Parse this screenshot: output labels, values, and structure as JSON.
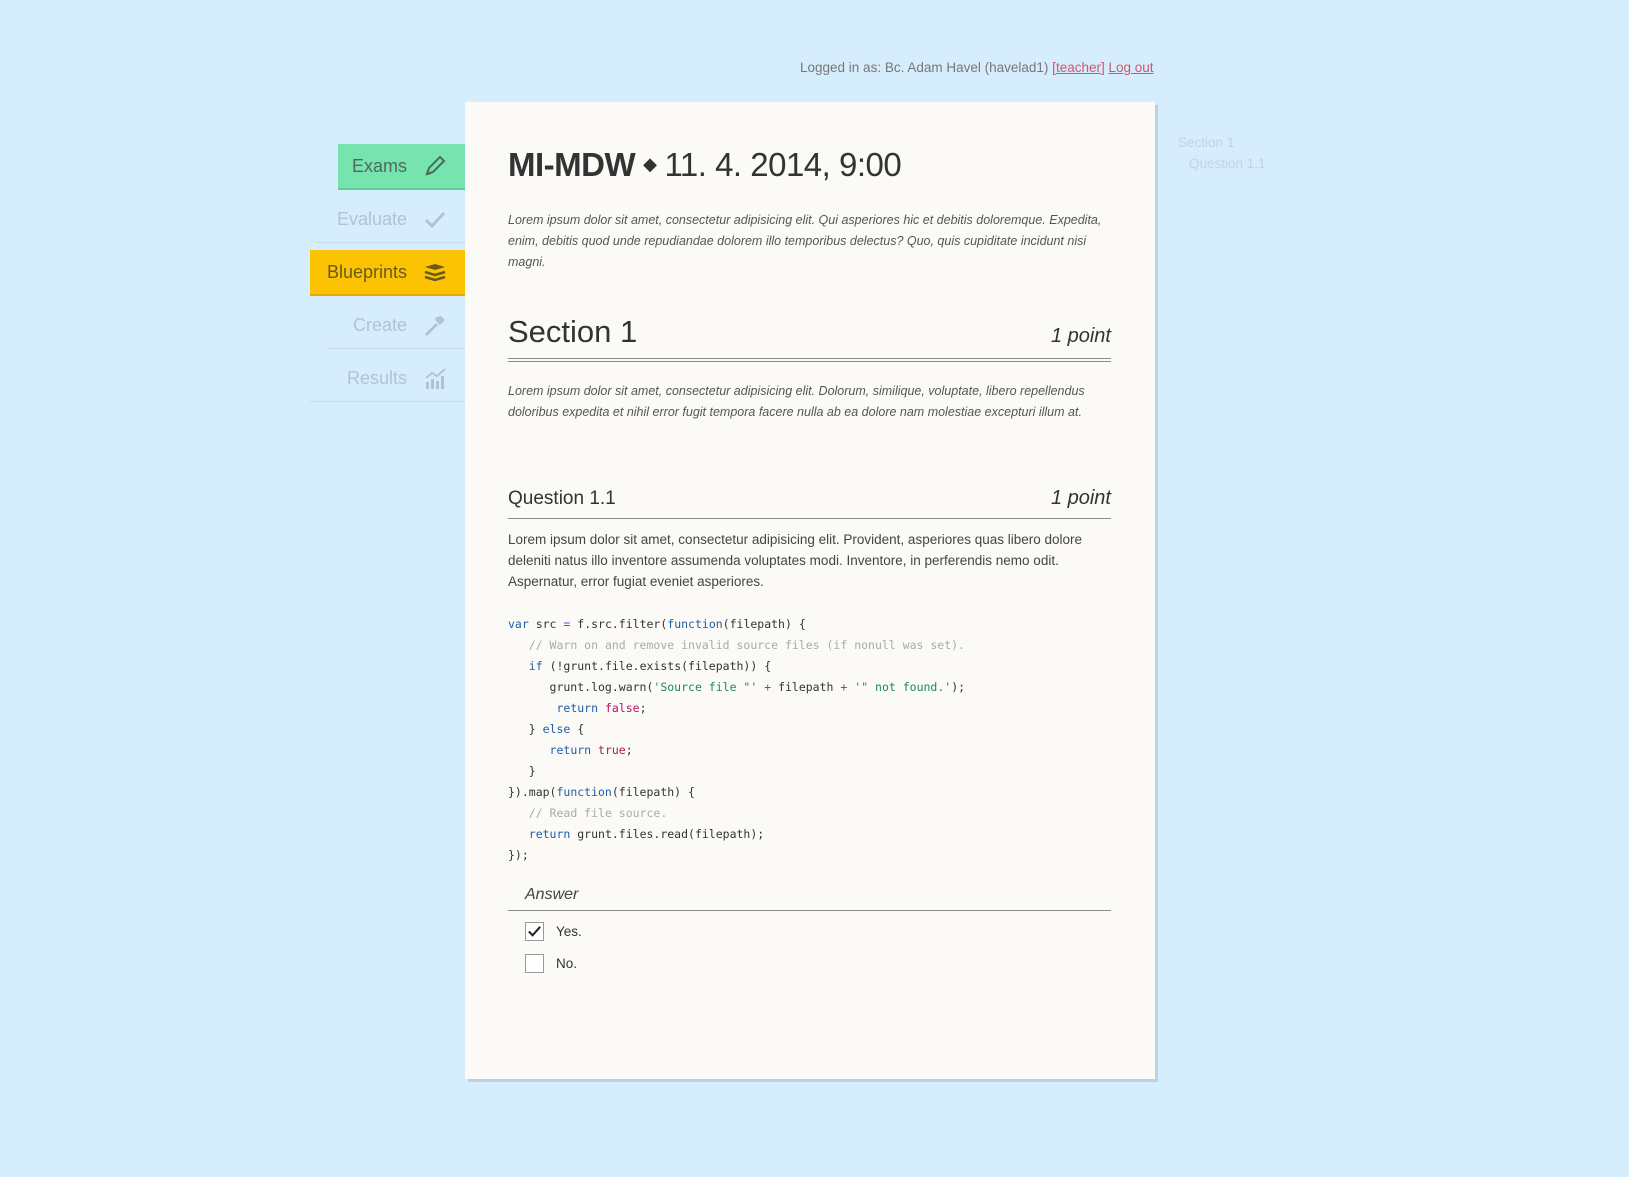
{
  "user_bar": {
    "prefix": "Logged in as: Bc. Adam Havel (havelad1)",
    "role": "teacher",
    "logout": "Log out"
  },
  "nav": {
    "items": [
      {
        "label": "Exams",
        "icon": "pencil-icon"
      },
      {
        "label": "Evaluate",
        "icon": "check-icon"
      },
      {
        "label": "Blueprints",
        "icon": "stack-icon"
      },
      {
        "label": "Create",
        "icon": "hammer-icon"
      },
      {
        "label": "Results",
        "icon": "chart-icon"
      }
    ]
  },
  "exam": {
    "course": "MI-MDW",
    "datetime": "11. 4. 2014, 9:00",
    "intro": "Lorem ipsum dolor sit amet, consectetur adipisicing elit. Qui asperiores hic et debitis doloremque. Expedita, enim, debitis quod unde repudiandae dolorem illo temporibus delectus? Quo, quis cupiditate incidunt nisi magni."
  },
  "section": {
    "title": "Section 1",
    "points": "1 point",
    "description": "Lorem ipsum dolor sit amet, consectetur adipisicing elit. Dolorum, similique, voluptate, libero repellendus doloribus expedita et nihil error fugit tempora facere nulla ab ea dolore nam molestiae excepturi illum at."
  },
  "question": {
    "title": "Question 1.1",
    "points": "1 point",
    "text": "Lorem ipsum dolor sit amet, consectetur adipisicing elit. Provident, asperiores quas libero dolore deleniti natus illo inventore assumenda voluptates modi. Inventore, in perferendis nemo odit. Aspernatur, error fugiat eveniet asperiores."
  },
  "answer": {
    "heading": "Answer",
    "options": [
      {
        "label": "Yes.",
        "checked": true
      },
      {
        "label": "No.",
        "checked": false
      }
    ]
  },
  "toc": {
    "section": "Section 1",
    "question": "Question 1.1"
  },
  "colors": {
    "background": "#d6edfd",
    "paper": "#fbfaf6",
    "exams_active": "#77e3ae",
    "blueprints_active": "#fbc303",
    "link": "#d2556b"
  }
}
